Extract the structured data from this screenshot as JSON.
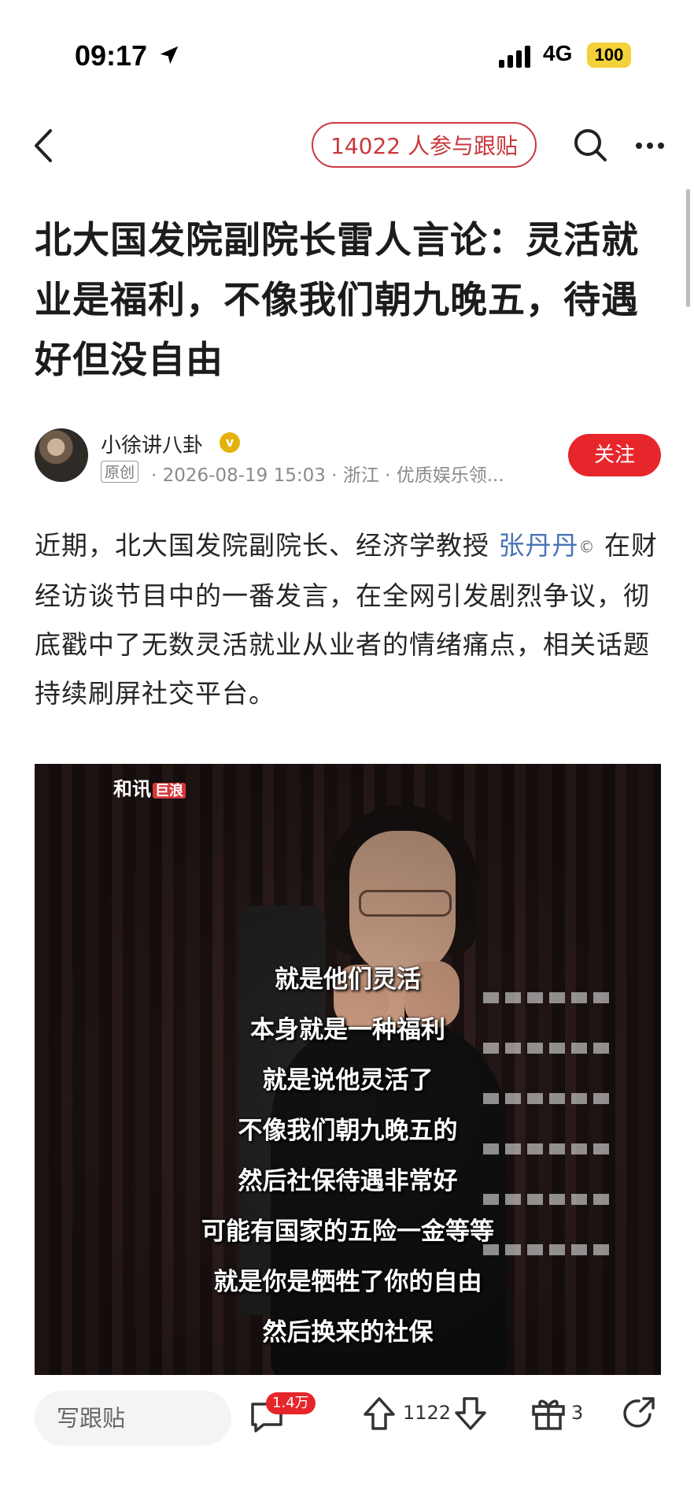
{
  "status_bar": {
    "time": "09:17",
    "network": "4G",
    "battery": "100"
  },
  "nav": {
    "participants_pill": "14022 人参与跟贴",
    "icons": [
      "back-icon",
      "search-icon",
      "more-icon"
    ]
  },
  "article": {
    "title": "北大国发院副院长雷人言论：灵活就业是福利，不像我们朝九晚五，待遇好但没自由",
    "author": {
      "name": "小徐讲八卦",
      "verified_badge": "v",
      "original_tag": "原创",
      "meta": "· 2026-08-19 15:03 · 浙江 · 优质娱乐领..."
    },
    "follow_label": "关注",
    "body_before": "近期，北大国发院副院长、经济学教授 ",
    "body_person": "张丹丹",
    "body_after": " 在财经访谈节目中的一番发言，在全网引发剧烈争议，彻底戳中了无数灵活就业从业者的情绪痛点，相关话题持续刷屏社交平台。"
  },
  "video": {
    "logo_main": "和讯",
    "logo_tag": "巨浪",
    "subtitles": [
      "就是他们灵活",
      "本身就是一种福利",
      "就是说他灵活了",
      "不像我们朝九晚五的",
      "然后社保待遇非常好",
      "可能有国家的五险一金等等",
      "就是你是牺牲了你的自由",
      "然后换来的社保"
    ]
  },
  "bottom_bar": {
    "reply_placeholder": "写跟贴",
    "comment_badge": "1.4万",
    "vote_count": "1122",
    "gift_count": "3"
  },
  "colors": {
    "accent_red": "#e7262c",
    "pill_red": "#c8383e",
    "link_blue": "#4a74b6",
    "badge_gold": "#e5b20b",
    "battery_yellow": "#f3d13a"
  }
}
